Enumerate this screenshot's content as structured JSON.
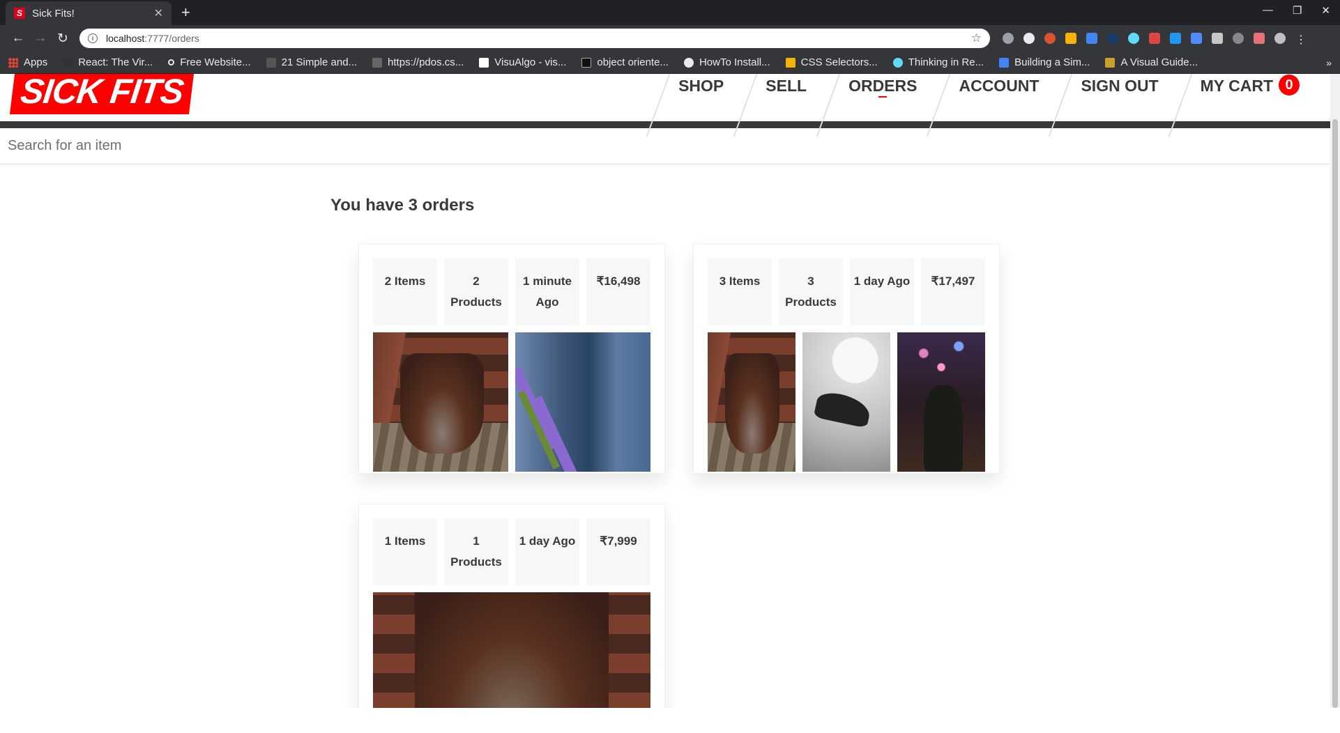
{
  "browser": {
    "tab_title": "Sick Fits!",
    "tab_favicon": "S",
    "url_host": "localhost",
    "url_path": ":7777/orders",
    "bookmarks": [
      {
        "label": "Apps",
        "icon": "apps-grid-icon"
      },
      {
        "label": "React: The Vir...",
        "icon": "bookmark-icon"
      },
      {
        "label": "Free Website...",
        "icon": "bookmark-icon"
      },
      {
        "label": "21 Simple and...",
        "icon": "bookmark-icon"
      },
      {
        "label": "https://pdos.cs...",
        "icon": "bookmark-icon"
      },
      {
        "label": "VisuAlgo - vis...",
        "icon": "bookmark-icon"
      },
      {
        "label": "object oriente...",
        "icon": "bookmark-icon"
      },
      {
        "label": "HowTo Install...",
        "icon": "github-icon"
      },
      {
        "label": "CSS Selectors...",
        "icon": "bookmark-icon"
      },
      {
        "label": "Thinking in Re...",
        "icon": "react-icon"
      },
      {
        "label": "Building a Sim...",
        "icon": "bookmark-icon"
      },
      {
        "label": "A Visual Guide...",
        "icon": "bookmark-icon"
      }
    ],
    "more": "»"
  },
  "site": {
    "logo": "SICK FITS",
    "nav": {
      "shop": "SHOP",
      "sell": "SELL",
      "orders": "ORDERS",
      "account": "ACCOUNT",
      "signout": "SIGN OUT",
      "cart": "MY CART",
      "cart_count": "0"
    },
    "search_placeholder": "Search for an item",
    "accent_color": "#ff0000"
  },
  "orders": {
    "heading": "You have 3 orders",
    "list": [
      {
        "items": "2 Items",
        "products": "2 Products",
        "time_l1": "1 minute",
        "time_l2": "Ago",
        "total": "₹16,498",
        "images": [
          "boots",
          "jeans"
        ]
      },
      {
        "items": "3 Items",
        "products": "3 Products",
        "time": "1 day Ago",
        "total": "₹17,497",
        "images": [
          "boots",
          "nike-shoe",
          "city-jacket"
        ]
      },
      {
        "items": "1 Items",
        "products": "1 Products",
        "time": "1 day Ago",
        "total": "₹7,999",
        "images": [
          "boots"
        ]
      }
    ]
  }
}
